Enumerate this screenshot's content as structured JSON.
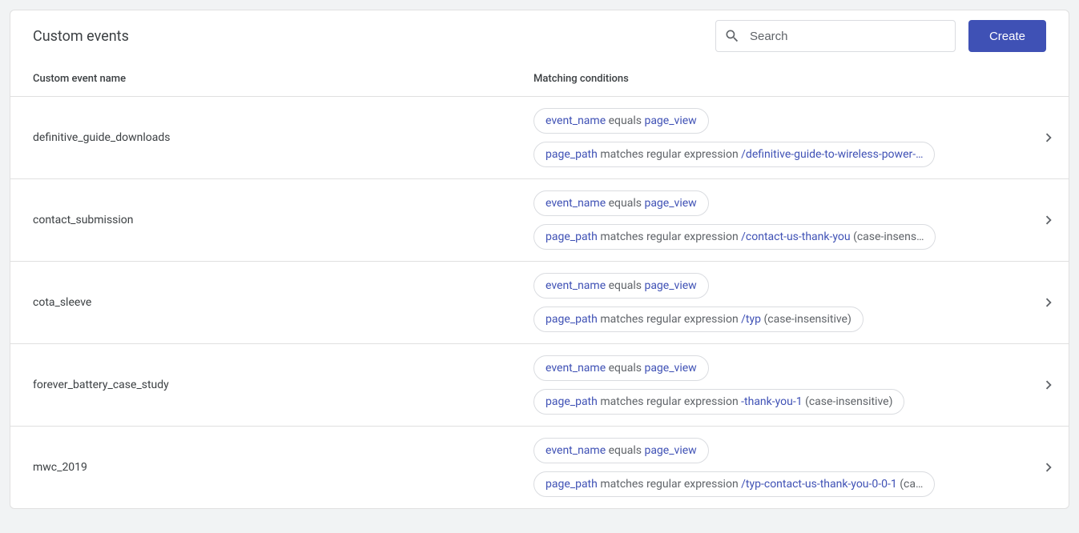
{
  "header": {
    "title": "Custom events",
    "search_placeholder": "Search",
    "create_label": "Create"
  },
  "columns": {
    "name": "Custom event name",
    "conditions": "Matching conditions"
  },
  "events": [
    {
      "name": "definitive_guide_downloads",
      "conditions": [
        {
          "param": "event_name",
          "op": "equals",
          "value": "page_view",
          "suffix": ""
        },
        {
          "param": "page_path",
          "op": "matches regular expression",
          "value": "/definitive-guide-to-wireless-power-…",
          "suffix": ""
        }
      ]
    },
    {
      "name": "contact_submission",
      "conditions": [
        {
          "param": "event_name",
          "op": "equals",
          "value": "page_view",
          "suffix": ""
        },
        {
          "param": "page_path",
          "op": "matches regular expression",
          "value": "/contact-us-thank-you",
          "suffix": " (case-insens…"
        }
      ]
    },
    {
      "name": "cota_sleeve",
      "conditions": [
        {
          "param": "event_name",
          "op": "equals",
          "value": "page_view",
          "suffix": ""
        },
        {
          "param": "page_path",
          "op": "matches regular expression",
          "value": "/typ",
          "suffix": " (case-insensitive)"
        }
      ]
    },
    {
      "name": "forever_battery_case_study",
      "conditions": [
        {
          "param": "event_name",
          "op": "equals",
          "value": "page_view",
          "suffix": ""
        },
        {
          "param": "page_path",
          "op": "matches regular expression",
          "value": "-thank-you-1",
          "suffix": " (case-insensitive)"
        }
      ]
    },
    {
      "name": "mwc_2019",
      "conditions": [
        {
          "param": "event_name",
          "op": "equals",
          "value": "page_view",
          "suffix": ""
        },
        {
          "param": "page_path",
          "op": "matches regular expression",
          "value": "/typ-contact-us-thank-you-0-0-1",
          "suffix": " (ca…"
        }
      ]
    }
  ]
}
